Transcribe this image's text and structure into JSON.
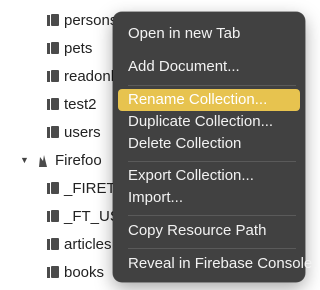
{
  "tree": {
    "rows": [
      {
        "type": "collection",
        "label": "persons"
      },
      {
        "type": "collection",
        "label": "pets"
      },
      {
        "type": "collection",
        "label": "readonl"
      },
      {
        "type": "collection",
        "label": "test2"
      },
      {
        "type": "collection",
        "label": "users"
      },
      {
        "type": "database",
        "label": "Firefoo"
      },
      {
        "type": "collection",
        "label": "_FIRETA"
      },
      {
        "type": "collection",
        "label": "_FT_US"
      },
      {
        "type": "collection",
        "label": "articles"
      },
      {
        "type": "collection",
        "label": "books"
      }
    ]
  },
  "context_menu": {
    "items": [
      {
        "label": "Open in new Tab"
      },
      {
        "label": "Add Document..."
      },
      {
        "label": "Rename Collection...",
        "highlighted": true
      },
      {
        "label": "Duplicate Collection..."
      },
      {
        "label": "Delete Collection"
      },
      {
        "label": "Export Collection..."
      },
      {
        "label": "Import..."
      },
      {
        "label": "Copy Resource Path"
      },
      {
        "label": "Reveal in Firebase Console"
      }
    ],
    "highlight_color": "#e7c34f",
    "background_color": "#414141"
  }
}
